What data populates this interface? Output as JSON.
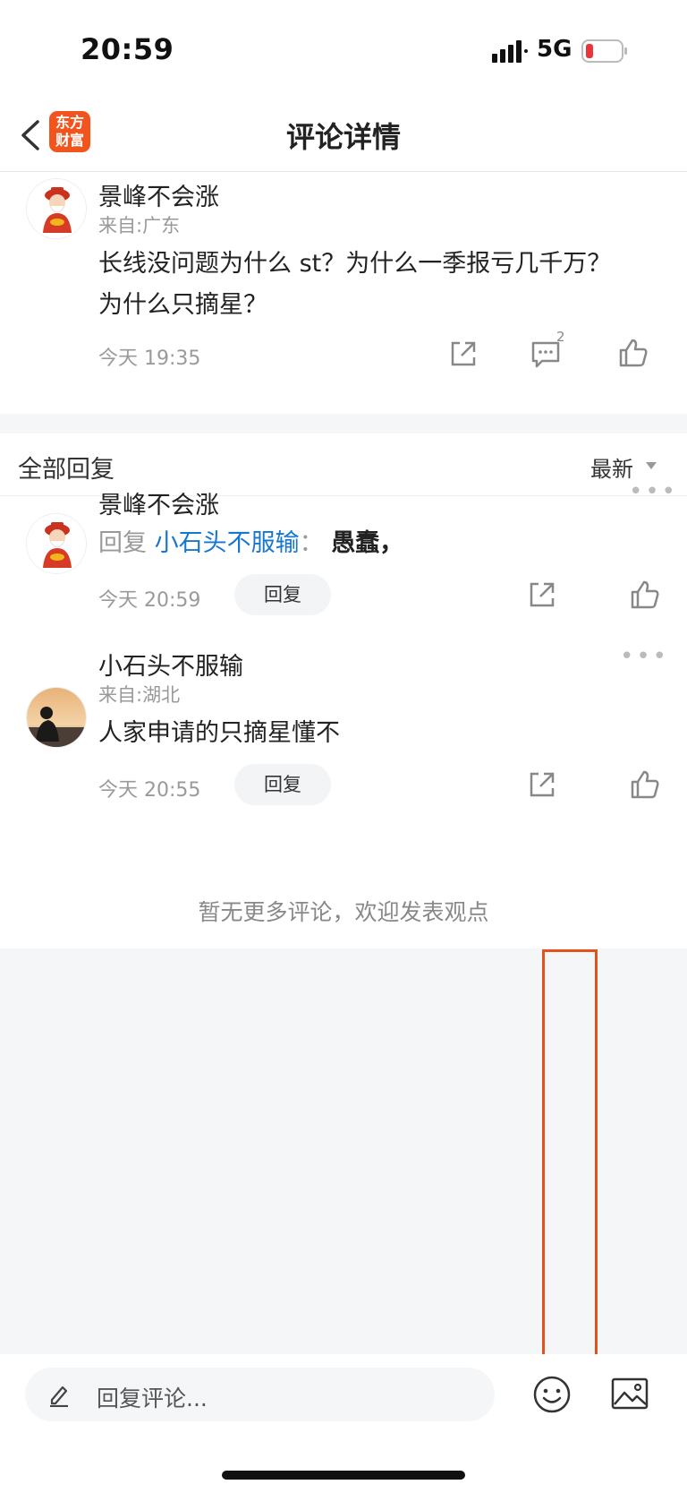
{
  "status_bar": {
    "time": "20:59",
    "network": "5G",
    "battery_color": "#e8343a"
  },
  "nav": {
    "logo_line1": "东方",
    "logo_line2": "财富",
    "title": "评论详情"
  },
  "main_comment": {
    "user": "景峰不会涨",
    "location": "来自:广东",
    "text_line1": "长线没问题为什么 st？为什么一季报亏几千万？",
    "text_line2": "为什么只摘星？",
    "time": "今天 19:35",
    "comment_count": "2"
  },
  "replies": {
    "title": "全部回复",
    "sort_label": "最新",
    "items": [
      {
        "user": "景峰不会涨",
        "reply_prefix": "回复",
        "reply_target": "小石头不服输",
        "reply_colon": "：",
        "text": "愚蠢，",
        "time": "今天 20:59",
        "reply_button": "回复"
      },
      {
        "user": "小石头不服输",
        "location": "来自:湖北",
        "text": "人家申请的只摘星懂不",
        "time": "今天 20:55",
        "reply_button": "回复"
      }
    ],
    "no_more": "暂无更多评论，欢迎发表观点"
  },
  "bottom_bar": {
    "input_placeholder": "回复评论..."
  },
  "colors": {
    "accent": "#f2541d",
    "link": "#1677d2",
    "highlight": "#e0531c"
  }
}
